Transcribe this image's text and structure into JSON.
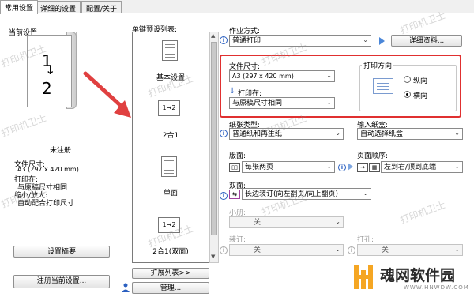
{
  "tabs": [
    "常用设置",
    "详细的设置",
    "配置/关于"
  ],
  "left": {
    "title": "当前设置",
    "preview": {
      "page1": "1",
      "page2": "2"
    },
    "profile_name": "未注册",
    "summary": [
      "文件尺寸:",
      "A3 (297 x 420 mm)",
      "打印在:",
      "与原稿尺寸相同",
      "缩小/放大:",
      "自动配合打印尺寸"
    ],
    "settings_summary_button": "设置摘要",
    "register_button": "注册当前设置..."
  },
  "presets": {
    "title": "单键预设列表:",
    "items": [
      "基本设置",
      "2合1",
      "单面",
      "2合1(双面)"
    ],
    "nup_glyph": "1→2",
    "expand_button": "扩展列表>>",
    "manage_button": "管理..."
  },
  "right": {
    "output_method": {
      "label": "作业方式:",
      "value": "普通打印",
      "details_button": "详细资料..."
    },
    "page_size": {
      "label": "文件尺寸:",
      "value": "A3 (297 x 420 mm)"
    },
    "output_size": {
      "label": "打印在:",
      "value": "与原稿尺寸相同"
    },
    "orientation": {
      "label": "打印方向",
      "options": [
        "纵向",
        "横向"
      ],
      "selected": "横向"
    },
    "paper_type": {
      "label": "纸张类型:",
      "value": "普通纸和再生纸"
    },
    "paper_source": {
      "label": "输入纸盒:",
      "value": "自动选择纸盒"
    },
    "layout": {
      "label": "版面:",
      "value": "每张两页"
    },
    "page_order": {
      "label": "页面顺序:",
      "value": "左到右/顶到底端"
    },
    "duplex": {
      "label": "双面:",
      "value": "长边装订(向左翻页/向上翻页)"
    },
    "booklet": {
      "label": "小册:",
      "value": "关"
    },
    "stapling": {
      "label": "装订:",
      "value": "关"
    },
    "punch": {
      "label": "打孔:",
      "value": "关"
    }
  },
  "watermark_text": "打印机卫士",
  "brand": {
    "name": "魂网软件园",
    "url": "WWW.HNWDW.COM"
  },
  "colors": {
    "highlight_box": "#e03030",
    "arrow": "#e04040",
    "accent": "#2a5fc0"
  }
}
